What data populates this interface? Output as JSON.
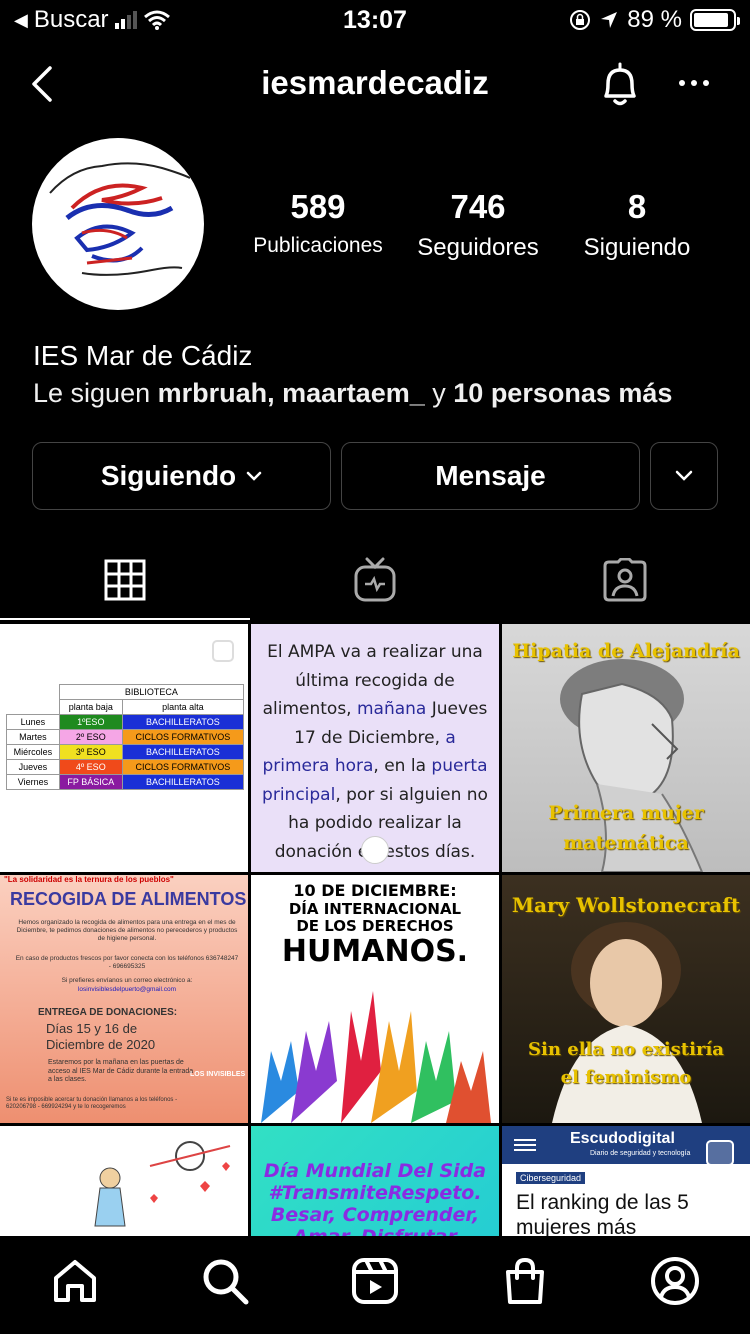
{
  "status_bar": {
    "back_app": "Buscar",
    "time": "13:07",
    "battery": "89 %",
    "battery_level": 0.89
  },
  "header": {
    "username": "iesmardecadiz"
  },
  "profile": {
    "stats": [
      {
        "value": "589",
        "label": "Publicaciones"
      },
      {
        "value": "746",
        "label": "Seguidores"
      },
      {
        "value": "8",
        "label": "Siguiendo"
      }
    ],
    "name": "IES Mar de Cádiz",
    "followed_by_prefix": "Le siguen",
    "followed_by_names": "mrbruah, maartaem_",
    "followed_by_join": "y",
    "followed_by_more": "10 personas más"
  },
  "buttons": {
    "following": "Siguiendo",
    "message": "Mensaje"
  },
  "tabs": [
    "grid-icon",
    "igtv-icon",
    "tagged-icon"
  ],
  "posts": {
    "p1": {
      "title": "BIBLIOTECA",
      "col_a": "planta baja",
      "col_b": "planta alta",
      "rows": [
        {
          "day": "Lunes",
          "a": "1ºESO",
          "b": "BACHILLERATOS",
          "ca": "#1f8a1f",
          "cb": "#1a2fd6"
        },
        {
          "day": "Martes",
          "a": "2º ESO",
          "b": "CICLOS FORMATIVOS",
          "ca": "#f5a6e6",
          "cb": "#f59a1a"
        },
        {
          "day": "Miércoles",
          "a": "3º ESO",
          "b": "BACHILLERATOS",
          "ca": "#f0e020",
          "cb": "#1a2fd6"
        },
        {
          "day": "Jueves",
          "a": "4º ESO",
          "b": "CICLOS FORMATIVOS",
          "ca": "#f04a1a",
          "cb": "#f59a1a"
        },
        {
          "day": "Viernes",
          "a": "FP BÁSICA",
          "b": "BACHILLERATOS",
          "ca": "#8a1aa0",
          "cb": "#1a2fd6"
        }
      ]
    },
    "p2": {
      "t1": "El AMPA va a realizar una última recogida de alimentos,",
      "t2": "mañana",
      "t3": "Jueves 17 de Diciembre,",
      "t4": "a primera hora",
      "t5": ", en la",
      "t6": "puerta principal",
      "t7": ", por si alguien no ha podido realizar la donación en estos días."
    },
    "p3": {
      "title": "Hipatia de Alejandría",
      "subtitle_1": "Primera mujer",
      "subtitle_2": "matemática"
    },
    "p4": {
      "banner": "\"La solidaridad es la ternura de los pueblos\"",
      "title": "RECOGIDA DE ALIMENTOS",
      "body_1": "Hemos organizado la recogida de alimentos para una entrega en el mes de Diciembre, te pedimos donaciones de alimentos no perecederos y productos de higiene personal.",
      "body_2": "En caso de productos frescos por favor conecta con los teléfonos 636748247 - 696695325",
      "body_3": "Si prefieres envíanos un correo electrónico a:",
      "email": "losinvisiblesdelpuerto@gmail.com",
      "delivery_title": "ENTREGA DE DONACIONES:",
      "delivery_1": "Días 15 y 16 de",
      "delivery_2": "Diciembre de 2020",
      "delivery_3": "Estaremos por la mañana en las puertas de acceso al IES Mar de Cádiz durante la entrada a las clases.",
      "footer": "Si te es imposible acercar tu donación llamanos a los teléfonos - 620206798 - 669924294 y te lo recogeremos",
      "logo": "LOS INVISIBLES"
    },
    "p5": {
      "l1": "10 DE DICIEMBRE:",
      "l2": "DÍA INTERNACIONAL",
      "l3": "DE LOS DERECHOS",
      "l4": "HUMANOS."
    },
    "p6": {
      "title": "Mary Wollstonecraft",
      "sub_1": "Sin ella no existiría",
      "sub_2": "el feminismo"
    },
    "p8": {
      "text": "Día Mundial Del Sida #TransmiteRespeto. Besar, Comprender, Amar, Disfrutar"
    },
    "p9": {
      "brand": "Escudodigital",
      "brand_sub": "Diario de seguridad y tecnología",
      "tag": "Ciberseguridad",
      "headline": "El ranking de las 5 mujeres más"
    }
  },
  "bottom_nav": [
    "home-icon",
    "search-icon",
    "reels-icon",
    "shop-icon",
    "profile-icon"
  ]
}
